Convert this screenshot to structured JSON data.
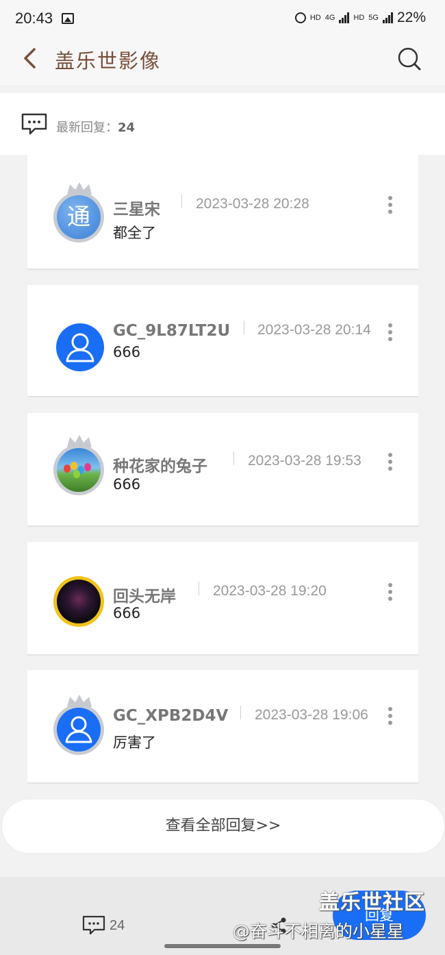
{
  "status_bar": {
    "time": "20:43",
    "net1": "HD",
    "net2": "4G",
    "net3": "HD",
    "net4": "5G",
    "battery": "22%"
  },
  "app_bar": {
    "title": "盖乐世影像"
  },
  "reply_header": {
    "label": "最新回复：",
    "count": "24"
  },
  "replies": [
    {
      "username": "三星宋",
      "date": "2023-03-28 20:28",
      "content": "都全了",
      "avatar": "tong-avatar",
      "crown": true
    },
    {
      "username": "GC_9L87LT2U",
      "date": "2023-03-28 20:14",
      "content": "666",
      "avatar": "default-user-avatar",
      "crown": false
    },
    {
      "username": "种花家的兔子",
      "date": "2023-03-28 19:53",
      "content": "666",
      "avatar": "balloon-avatar",
      "crown": true
    },
    {
      "username": "回头无岸",
      "date": "2023-03-28 19:20",
      "content": "666",
      "avatar": "dark-avatar",
      "crown": false
    },
    {
      "username": "GC_XPB2D4V",
      "date": "2023-03-28 19:06",
      "content": "厉害了",
      "avatar": "default-user-avatar",
      "crown": true
    }
  ],
  "view_all": {
    "label": "查看全部回复>>"
  },
  "bottom_bar": {
    "comment_count": "24",
    "reply_label": "回复"
  },
  "watermark": {
    "line1": "盖乐世社区",
    "line2": "@奋斗不相离的小星星"
  },
  "colors": {
    "title": "#7a4e3a",
    "accent": "#1a6ef5",
    "background": "#f2f2f2"
  }
}
